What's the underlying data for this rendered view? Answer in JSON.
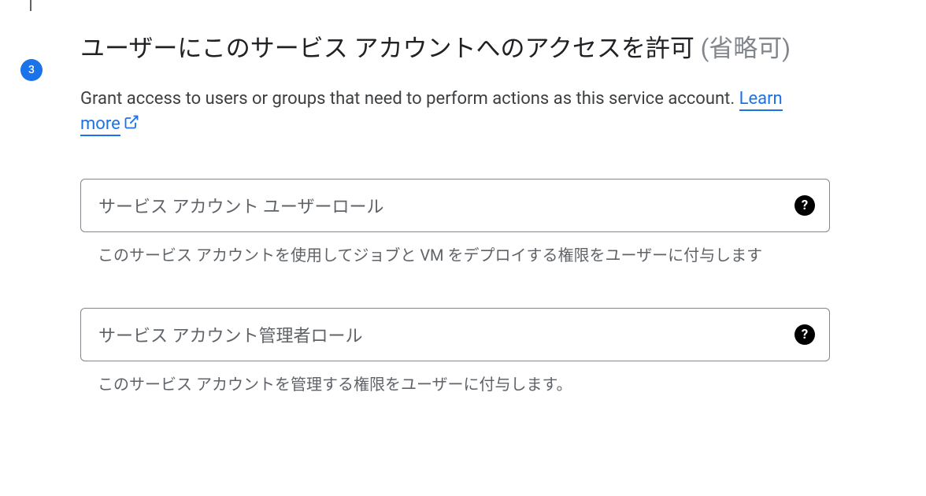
{
  "step": {
    "number": "3",
    "title_main": "ユーザーにこのサービス アカウントへのアクセスを許可 ",
    "title_optional": "(省略可)"
  },
  "description": {
    "text_before_link": "Grant access to users or groups that need to perform actions as this service account. ",
    "link_text": "Learn more"
  },
  "fields": {
    "user_role": {
      "placeholder": "サービス アカウント ユーザーロール",
      "helper": "このサービス アカウントを使用してジョブと VM をデプロイする権限をユーザーに付与します"
    },
    "admin_role": {
      "placeholder": "サービス アカウント管理者ロール",
      "helper": "このサービス アカウントを管理する権限をユーザーに付与します。"
    }
  },
  "icons": {
    "help": "?"
  }
}
